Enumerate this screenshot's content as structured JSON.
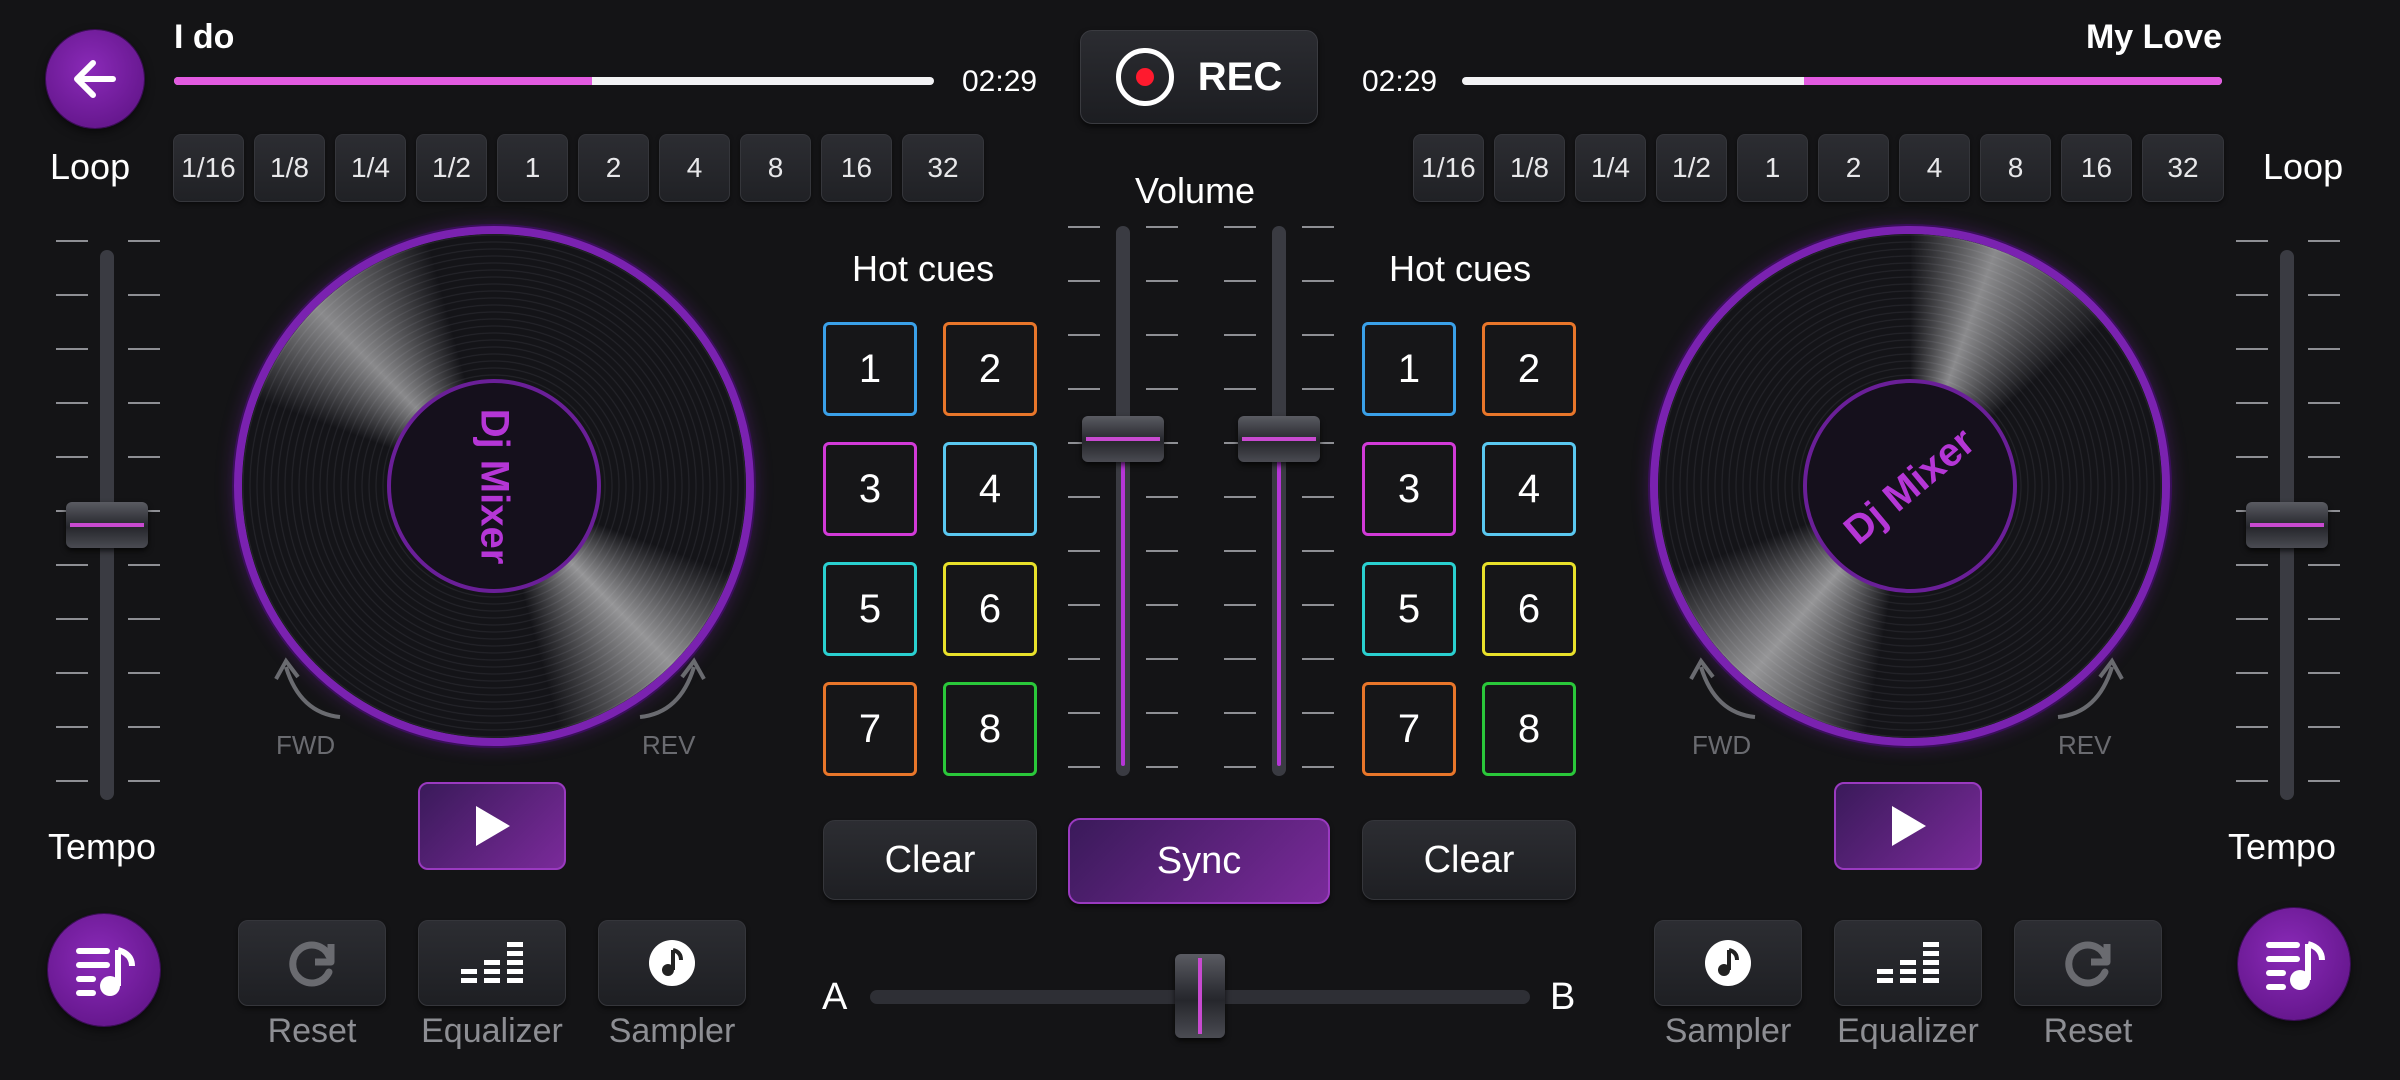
{
  "deck_left": {
    "track_title": "I do",
    "time": "02:29",
    "progress": 0.55,
    "loop_label": "Loop",
    "tempo_label": "Tempo",
    "platter_label": "Dj Mixer",
    "fwd_label": "FWD",
    "rev_label": "REV",
    "tools": [
      "Reset",
      "Equalizer",
      "Sampler"
    ]
  },
  "deck_right": {
    "track_title": "My Love",
    "time": "02:29",
    "progress": 0.55,
    "loop_label": "Loop",
    "tempo_label": "Tempo",
    "platter_label": "Dj Mixer",
    "fwd_label": "FWD",
    "rev_label": "REV",
    "tools": [
      "Sampler",
      "Equalizer",
      "Reset"
    ]
  },
  "loop_values": [
    "1/16",
    "1/8",
    "1/4",
    "1/2",
    "1",
    "2",
    "4",
    "8",
    "16",
    "32"
  ],
  "rec_label": "REC",
  "volume_label": "Volume",
  "hot_cues_label": "Hot cues",
  "hot_cues": [
    "1",
    "2",
    "3",
    "4",
    "5",
    "6",
    "7",
    "8"
  ],
  "cue_colors": [
    "#3aa0e8",
    "#e8762a",
    "#d23ad8",
    "#5ac8f0",
    "#2ad0d0",
    "#e8e02a",
    "#e8762a",
    "#2ac83a"
  ],
  "clear_label": "Clear",
  "sync_label": "Sync",
  "crossfader": {
    "a_label": "A",
    "b_label": "B",
    "position": 0.5
  },
  "accent_color": "#b536d6"
}
